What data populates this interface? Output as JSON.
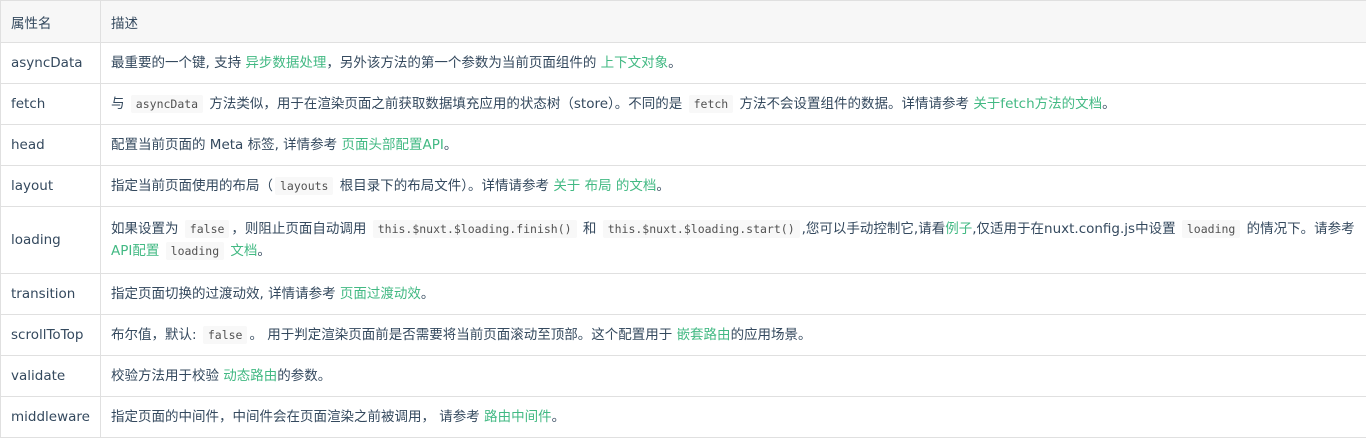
{
  "header": {
    "col_name": "属性名",
    "col_desc": "描述"
  },
  "colors": {
    "link": "#42b983",
    "border": "#e0e0e0",
    "header_bg": "#f7f7f7",
    "text": "#34495e"
  },
  "rows": [
    {
      "name": "asyncData",
      "p": [
        "最重要的一个键, 支持 ",
        "，另外该方法的第一个参数为当前页面组件的 ",
        "。"
      ],
      "a": [
        "异步数据处理",
        "上下文对象"
      ]
    },
    {
      "name": "fetch",
      "p": [
        "与 ",
        " 方法类似，用于在渲染页面之前获取数据填充应用的状态树（store）。不同的是 ",
        " 方法不会设置组件的数据。详情请参考 ",
        "。"
      ],
      "c": [
        "asyncData",
        "fetch"
      ],
      "a": [
        "关于fetch方法的文档"
      ]
    },
    {
      "name": "head",
      "p": [
        "配置当前页面的 Meta 标签, 详情参考 ",
        "。"
      ],
      "a": [
        "页面头部配置API"
      ]
    },
    {
      "name": "layout",
      "p": [
        "指定当前页面使用的布局（",
        " 根目录下的布局文件）。详情请参考 ",
        "。"
      ],
      "c": [
        "layouts"
      ],
      "a": [
        "关于 布局 的文档"
      ]
    },
    {
      "name": "loading",
      "p": [
        "如果设置为 ",
        "，则阻止页面自动调用 ",
        " 和 ",
        ",您可以手动控制它,请看",
        ",仅适用于在nuxt.config.js中设置 ",
        " 的情况下。请参考",
        " ",
        " ",
        "。"
      ],
      "c": [
        "false",
        "this.$nuxt.$loading.finish()",
        "this.$nuxt.$loading.start()",
        "loading",
        "loading"
      ],
      "a": [
        "例子",
        "API配置",
        "文档"
      ]
    },
    {
      "name": "transition",
      "p": [
        "指定页面切换的过渡动效, 详情请参考 ",
        "。"
      ],
      "a": [
        "页面过渡动效"
      ]
    },
    {
      "name": "scrollToTop",
      "p": [
        "布尔值，默认: ",
        "。 用于判定渲染页面前是否需要将当前页面滚动至顶部。这个配置用于 ",
        "的应用场景。"
      ],
      "c": [
        "false"
      ],
      "a": [
        "嵌套路由"
      ]
    },
    {
      "name": "validate",
      "p": [
        "校验方法用于校验 ",
        "的参数。"
      ],
      "a": [
        "动态路由"
      ]
    },
    {
      "name": "middleware",
      "p": [
        "指定页面的中间件，中间件会在页面渲染之前被调用， 请参考 ",
        "。"
      ],
      "a": [
        "路由中间件"
      ]
    }
  ]
}
